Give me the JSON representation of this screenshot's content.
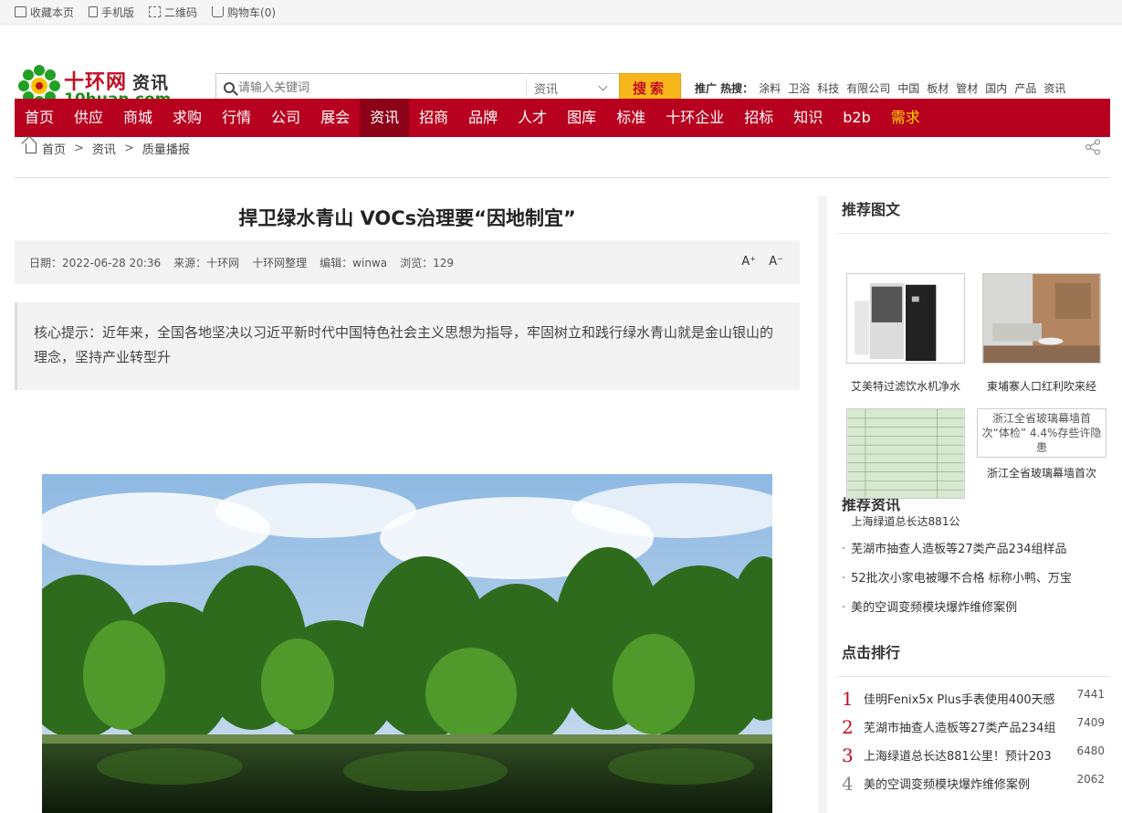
{
  "topbar": {
    "items": [
      {
        "label": "收藏本页",
        "icon": "bookmark-icon"
      },
      {
        "label": "手机版",
        "icon": "phone-icon"
      },
      {
        "label": "二维码",
        "icon": "qr-code-icon"
      },
      {
        "label": "购物车(0)",
        "icon": "cart-icon"
      }
    ]
  },
  "logo": {
    "cn": "十环网",
    "sub": "资讯",
    "en": "10huan.com"
  },
  "search": {
    "placeholder": "请输入关键词",
    "category": "资讯",
    "button": "搜索"
  },
  "hot": {
    "label": "推广 热搜：",
    "terms": [
      "涂料",
      "卫浴",
      "科技",
      "有限公司",
      "中国",
      "板材",
      "管材",
      "国内",
      "产品",
      "资讯"
    ]
  },
  "nav": {
    "items": [
      "首页",
      "供应",
      "商城",
      "求购",
      "行情",
      "公司",
      "展会",
      "资讯",
      "招商",
      "品牌",
      "人才",
      "图库",
      "标准",
      "十环企业",
      "招标",
      "知识",
      "b2b",
      "需求"
    ],
    "active": "资讯",
    "highlight": "需求"
  },
  "breadcrumb": {
    "items": [
      "首页",
      "资讯",
      "质量播报"
    ],
    "sep": ">"
  },
  "article": {
    "title": "捍卫绿水青山 VOCs治理要“因地制宜”",
    "date": "日期：2022-06-28 20:36",
    "source": "来源：十环网",
    "source2": "十环网整理",
    "editor": "编辑：winwa",
    "views": "浏览：129",
    "font_up": "A⁺",
    "font_down": "A⁻",
    "summary": "核心提示：近年来，全国各地坚决以习近平新时代中国特色社会主义思想为指导，牢固树立和践行绿水青山就是金山银山的理念，坚持产业转型升"
  },
  "sidebar": {
    "pics_title": "推荐图文",
    "pics": [
      {
        "caption": "艾美特过滤饮水机净水"
      },
      {
        "caption": "東埔寨人口红利吹来经"
      },
      {
        "caption": "上海绿道总长达881公"
      },
      {
        "caption": "浙江全省玻璃幕墙首次",
        "alt": "浙江全省玻璃幕墙首次“体检” 4.4%存些许隐患"
      }
    ],
    "news_title": "推荐资讯",
    "news": [
      "芜湖市抽查人造板等27类产品234组样品",
      "52批次小家电被曝不合格 标称小鸭、万宝",
      "美的空调变频模块爆炸维修案例"
    ],
    "rank_title": "点击排行",
    "rank": [
      {
        "n": "1",
        "title": "佳明Fenix5x Plus手表使用400天感",
        "count": "7441"
      },
      {
        "n": "2",
        "title": "芜湖市抽查人造板等27类产品234组",
        "count": "7409"
      },
      {
        "n": "3",
        "title": "上海绿道总长达881公里！预计203",
        "count": "6480"
      },
      {
        "n": "4",
        "title": "美的空调变频模块爆炸维修案例",
        "count": "2062"
      }
    ]
  }
}
